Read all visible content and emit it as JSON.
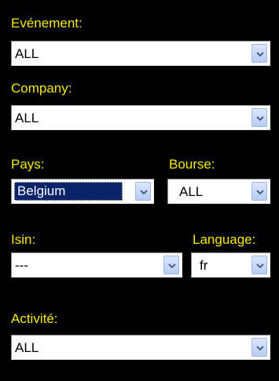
{
  "colors": {
    "background": "#000000",
    "label": "#f6e900",
    "selection": "#0a246a"
  },
  "icons": {
    "dropdown": "chevron-down-icon"
  },
  "fields": {
    "evenement": {
      "label": "Evénement:",
      "value": "ALL"
    },
    "company": {
      "label": "Company:",
      "value": "ALL"
    },
    "pays": {
      "label": "Pays:",
      "value": "Belgium"
    },
    "bourse": {
      "label": "Bourse:",
      "value": "ALL"
    },
    "isin": {
      "label": "Isin:",
      "value": "---"
    },
    "language": {
      "label": "Language:",
      "value": "fr"
    },
    "activite": {
      "label": "Activité:",
      "value": "ALL"
    }
  }
}
